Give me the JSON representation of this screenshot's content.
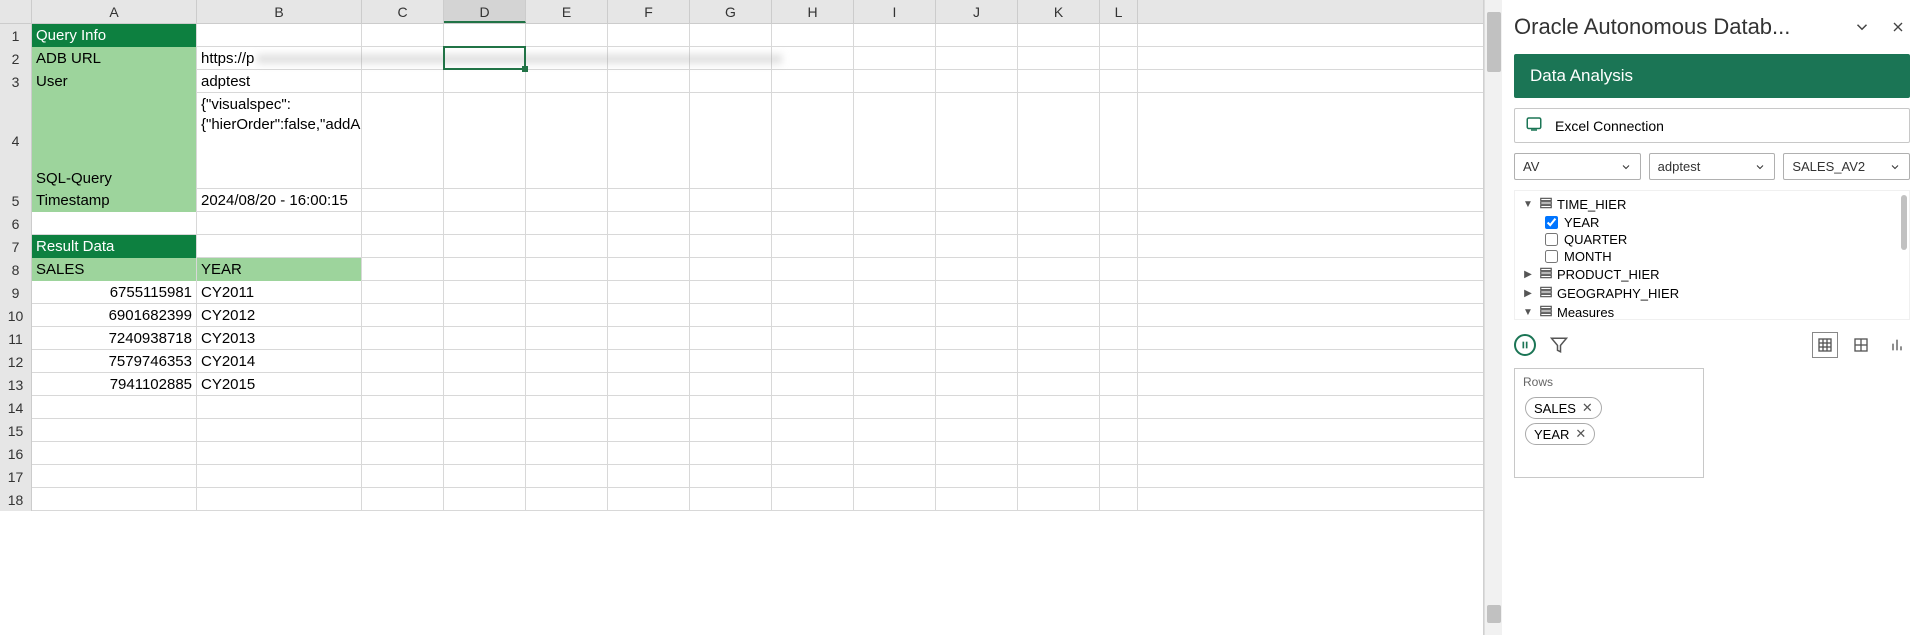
{
  "columns": [
    "A",
    "B",
    "C",
    "D",
    "E",
    "F",
    "G",
    "H",
    "I",
    "J",
    "K",
    "L"
  ],
  "selected_column": "D",
  "row_heights": {
    "1": 23,
    "2": 23,
    "3": 23,
    "4": 96,
    "5": 23,
    "6": 23,
    "7": 23,
    "8": 23,
    "9": 23,
    "10": 23,
    "11": 23,
    "12": 23,
    "13": 23,
    "14": 23,
    "15": 23,
    "16": 23,
    "17": 23,
    "18": 23
  },
  "cells": {
    "A1": {
      "text": "Query Info",
      "cls": "dark-green"
    },
    "A2": {
      "text": "ADB URL",
      "cls": "light-green"
    },
    "B2": {
      "text": "https://p",
      "overflow": "blurred-url"
    },
    "A3": {
      "text": "User",
      "cls": "light-green"
    },
    "B3": {
      "text": "adptest"
    },
    "A4": {
      "text": "SQL-Query",
      "cls": "light-green",
      "valign": "bottom"
    },
    "B4": {
      "text": "{\"visualspec\":{\"hierOrder\":false,\"addAllHiers\":false,\"addAllMeas\":false,\"levels\":tru",
      "wrap": true
    },
    "A5": {
      "text": "Timestamp",
      "cls": "light-green"
    },
    "B5": {
      "text": "2024/08/20 - 16:00:15"
    },
    "A7": {
      "text": "Result Data",
      "cls": "dark-green"
    },
    "A8": {
      "text": "SALES",
      "cls": "light-green"
    },
    "B8": {
      "text": "YEAR",
      "cls": "light-green"
    },
    "A9": {
      "text": "6755115981",
      "align": "right"
    },
    "B9": {
      "text": "CY2011"
    },
    "A10": {
      "text": "6901682399",
      "align": "right"
    },
    "B10": {
      "text": "CY2012"
    },
    "A11": {
      "text": "7240938718",
      "align": "right"
    },
    "B11": {
      "text": "CY2013"
    },
    "A12": {
      "text": "7579746353",
      "align": "right"
    },
    "B12": {
      "text": "CY2014"
    },
    "A13": {
      "text": "7941102885",
      "align": "right"
    },
    "B13": {
      "text": "CY2015"
    }
  },
  "panel": {
    "title": "Oracle Autonomous Datab...",
    "section": "Data Analysis",
    "connection_label": "Excel Connection",
    "dropdowns": {
      "d1": "AV",
      "d2": "adptest",
      "d3": "SALES_AV2"
    },
    "tree": {
      "time_hier": {
        "label": "TIME_HIER",
        "expanded": true,
        "children": [
          {
            "label": "YEAR",
            "checked": true
          },
          {
            "label": "QUARTER",
            "checked": false
          },
          {
            "label": "MONTH",
            "checked": false
          }
        ]
      },
      "product_hier": {
        "label": "PRODUCT_HIER",
        "expanded": false
      },
      "geography_hier": {
        "label": "GEOGRAPHY_HIER",
        "expanded": false
      },
      "measures": {
        "label": "Measures",
        "expanded": true
      }
    },
    "rows_label": "Rows",
    "chips": [
      "SALES",
      "YEAR"
    ]
  }
}
